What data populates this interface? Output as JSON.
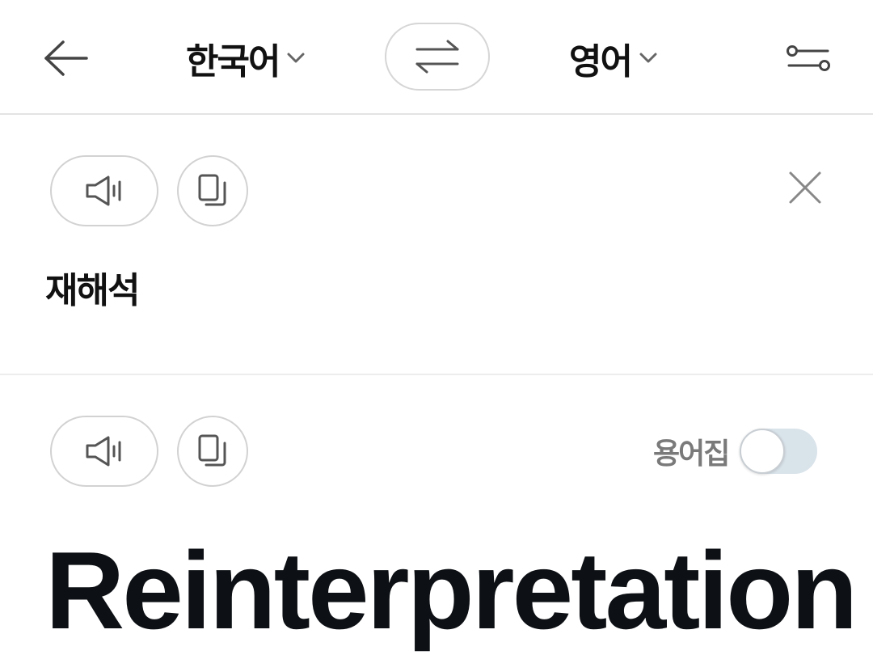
{
  "header": {
    "source_language": "한국어",
    "target_language": "영어",
    "icons": {
      "back": "arrow-left-icon",
      "source_dropdown": "chevron-down-icon",
      "swap": "swap-arrows-icon",
      "target_dropdown": "chevron-down-icon",
      "settings": "sliders-icon"
    }
  },
  "source": {
    "text": "재해석",
    "icons": {
      "speak": "speaker-icon",
      "copy": "copy-icon",
      "clear": "close-icon"
    }
  },
  "target": {
    "text": "Reinterpretation",
    "glossary_label": "용어집",
    "glossary_enabled": false,
    "icons": {
      "speak": "speaker-icon",
      "copy": "copy-icon"
    }
  },
  "colors": {
    "text_primary": "#111111",
    "text_secondary": "#7a7a7a",
    "border": "#d2d2d2",
    "toggle_off_track": "#d9e3ea",
    "icon": "#555555"
  }
}
